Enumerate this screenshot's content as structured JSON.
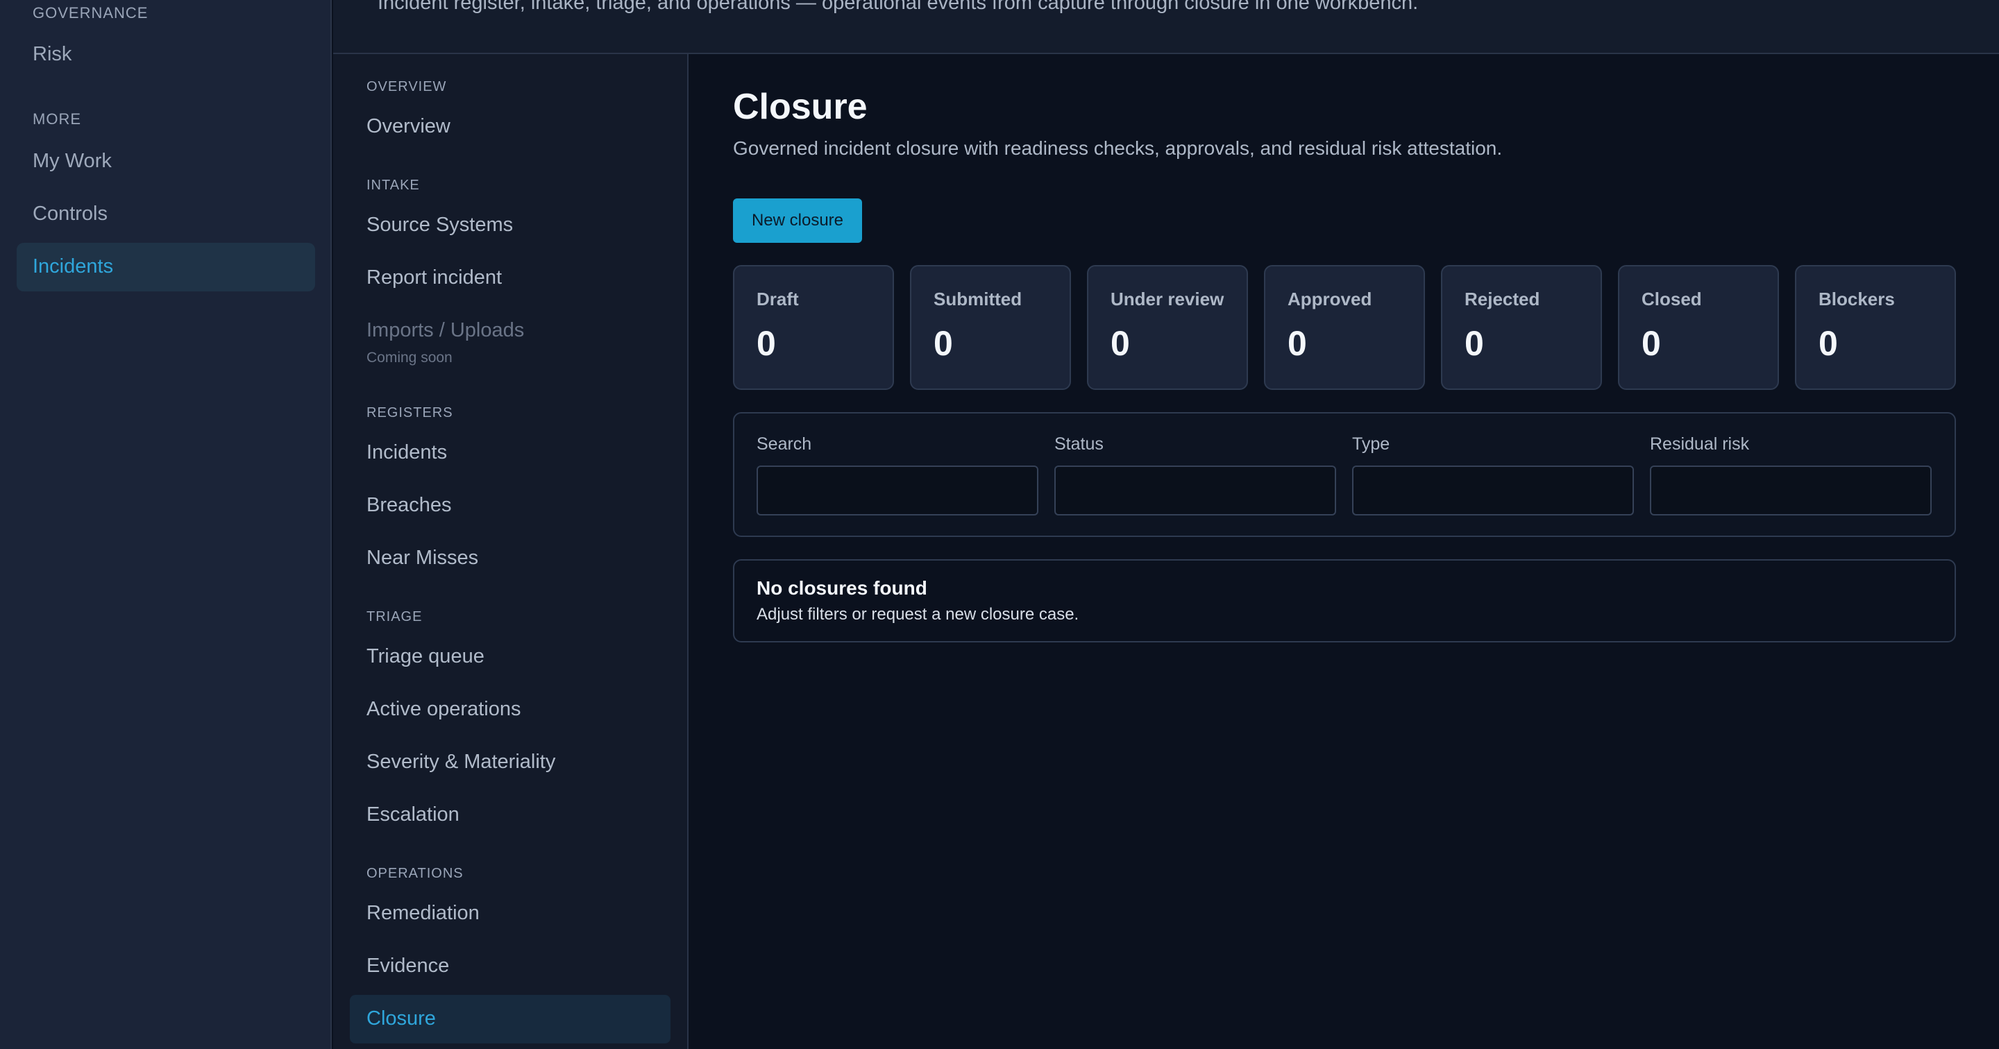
{
  "header": {
    "description": "Incident register, intake, triage, and operations — operational events from capture through closure in one workbench."
  },
  "sidebar": {
    "sections": [
      {
        "label": "GOVERNANCE",
        "items": [
          {
            "label": "Risk"
          }
        ]
      },
      {
        "label": "MORE",
        "items": [
          {
            "label": "My Work"
          },
          {
            "label": "Controls"
          },
          {
            "label": "Incidents",
            "active": true
          }
        ]
      }
    ]
  },
  "subnav": {
    "overview": {
      "label": "OVERVIEW",
      "items": [
        "Overview"
      ]
    },
    "intake": {
      "label": "INTAKE",
      "items": [
        "Source Systems",
        "Report incident",
        "Imports / Uploads"
      ],
      "imports_note": "Coming soon"
    },
    "registers": {
      "label": "REGISTERS",
      "items": [
        "Incidents",
        "Breaches",
        "Near Misses"
      ]
    },
    "triage": {
      "label": "TRIAGE",
      "items": [
        "Triage queue",
        "Active operations",
        "Severity & Materiality",
        "Escalation"
      ]
    },
    "operations": {
      "label": "OPERATIONS",
      "items": [
        "Remediation",
        "Evidence",
        "Closure"
      ]
    }
  },
  "main": {
    "title": "Closure",
    "subtitle": "Governed incident closure with readiness checks, approvals, and residual risk attestation.",
    "new_button": "New closure",
    "stats": [
      {
        "label": "Draft",
        "value": "0"
      },
      {
        "label": "Submitted",
        "value": "0"
      },
      {
        "label": "Under review",
        "value": "0"
      },
      {
        "label": "Approved",
        "value": "0"
      },
      {
        "label": "Rejected",
        "value": "0"
      },
      {
        "label": "Closed",
        "value": "0"
      },
      {
        "label": "Blockers",
        "value": "0"
      }
    ],
    "filters": [
      {
        "label": "Search",
        "value": ""
      },
      {
        "label": "Status",
        "value": ""
      },
      {
        "label": "Type",
        "value": ""
      },
      {
        "label": "Residual risk",
        "value": ""
      }
    ],
    "empty": {
      "title": "No closures found",
      "text": "Adjust filters or request a new closure case."
    }
  },
  "colors": {
    "accent": "#2fa6db",
    "button": "#1aa0cf",
    "background": "#0b111e",
    "sidebar": "#1b2438"
  }
}
